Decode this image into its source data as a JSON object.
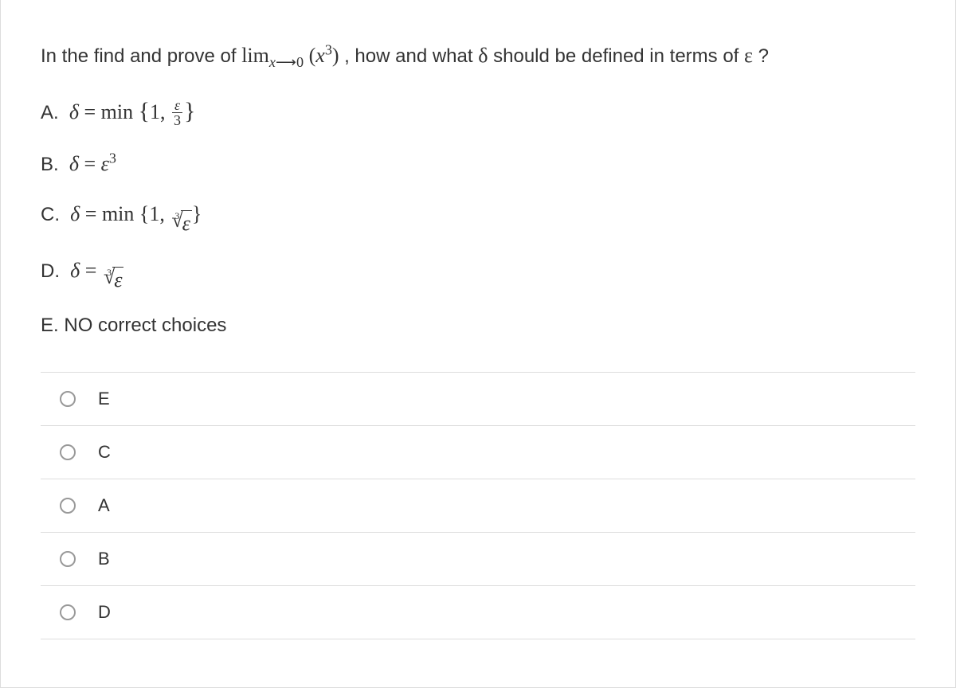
{
  "question": {
    "part1": "In the find and prove of ",
    "limit_expr": "lim",
    "limit_sub1": "x",
    "limit_arrow": "⟶",
    "limit_sub2": "0",
    "limit_arg_open": "(",
    "limit_arg_x": "x",
    "limit_arg_exp": "3",
    "limit_arg_close": ")",
    "part2": ",  how and what ",
    "delta": "δ",
    "part3": " should be defined in terms of ",
    "epsilon": "ε",
    "part4": "?"
  },
  "choices": {
    "A": {
      "letter": "A.",
      "delta": "δ",
      "eq": " = ",
      "min": "min",
      "brace_open": "{",
      "one": "1",
      "comma": ", ",
      "frac_num": "ε",
      "frac_den": "3",
      "brace_close": "}"
    },
    "B": {
      "letter": "B.",
      "delta": "δ",
      "eq": " = ",
      "eps": "ε",
      "exp": "3"
    },
    "C": {
      "letter": "C.",
      "delta": "δ",
      "eq": " = ",
      "min": "min",
      "brace_open": "{",
      "one": "1",
      "comma": ", ",
      "root_index": "3",
      "root_radicand": "ε",
      "brace_close": "}"
    },
    "D": {
      "letter": "D.",
      "delta": "δ",
      "eq": " = ",
      "root_index": "3",
      "root_radicand": "ε"
    },
    "E": {
      "letter": "E.",
      "text": "NO correct choices"
    }
  },
  "options": [
    "E",
    "C",
    "A",
    "B",
    "D"
  ]
}
